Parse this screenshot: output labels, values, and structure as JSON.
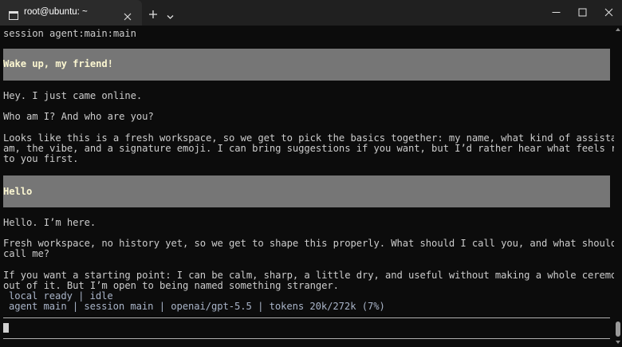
{
  "window": {
    "tab_title": "root@ubuntu: ~",
    "icons": {
      "tab": "terminal-icon",
      "close_tab": "close-icon",
      "new_tab": "plus-icon",
      "dropdown": "chevron-down-icon",
      "minimize": "minimize-icon",
      "maximize": "maximize-icon",
      "close_window": "close-icon"
    }
  },
  "terminal": {
    "header": "session agent:main:main",
    "messages": [
      {
        "role": "user",
        "text": "Wake up, my friend!"
      },
      {
        "role": "assistant",
        "lines": [
          "Hey. I just came online.",
          "",
          "Who am I? And who are you?",
          "",
          "Looks like this is a fresh workspace, so we get to pick the basics together: my name, what kind of assistant I",
          "am, the vibe, and a signature emoji. I can bring suggestions if you want, but I’d rather hear what feels right",
          "to you first."
        ]
      },
      {
        "role": "user",
        "text": "Hello"
      },
      {
        "role": "assistant",
        "lines": [
          "Hello. I’m here.",
          "",
          "Fresh workspace, no history yet, so we get to shape this properly. What should I call you, and what should you",
          "call me?",
          "",
          "If you want a starting point: I can be calm, sharp, a little dry, and useful without making a whole ceremony",
          "out of it. But I’m open to being named something stranger."
        ]
      }
    ],
    "status_line_1": "local ready | idle",
    "status_line_2": "agent main | session main | openai/gpt-5.5 | tokens 20k/272k (7%)",
    "input_value": ""
  },
  "colors": {
    "background": "#0c0c0c",
    "text": "#cccccc",
    "user_message_bg": "#767676",
    "user_message_text": "#fbf6d1",
    "status_text": "#a9b4c8",
    "titlebar": "#202020",
    "active_tab": "#2b2b2b"
  }
}
